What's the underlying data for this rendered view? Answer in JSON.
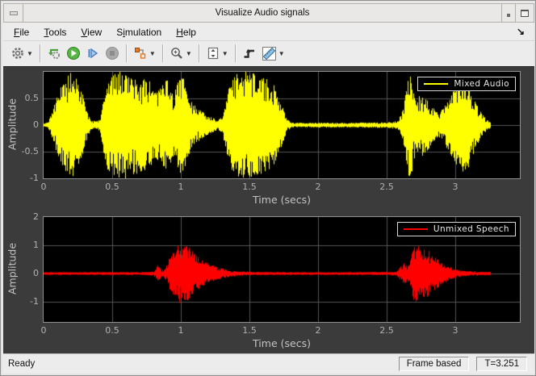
{
  "window": {
    "title": "Visualize Audio signals"
  },
  "menu": {
    "items": [
      {
        "pre": "",
        "key": "F",
        "post": "ile"
      },
      {
        "pre": "",
        "key": "T",
        "post": "ools"
      },
      {
        "pre": "",
        "key": "V",
        "post": "iew"
      },
      {
        "pre": "S",
        "key": "i",
        "post": "mulation"
      },
      {
        "pre": "",
        "key": "H",
        "post": "elp"
      }
    ],
    "dock_arrow": "↘"
  },
  "toolbar": {
    "buttons": [
      "settings-gear-dropdown",
      "step-back",
      "run-play",
      "step-forward",
      "stop",
      "signal-selector-dropdown",
      "zoom-dropdown",
      "fit-to-view-dropdown",
      "trigger",
      "measurements-ruler-dropdown"
    ]
  },
  "status": {
    "left": "Ready",
    "frame_mode": "Frame based",
    "sim_time": "T=3.251"
  },
  "colors": {
    "scope_bg": "#3b3b3b",
    "plot_bg": "#000000",
    "grid": "#565656",
    "tick_text": "#b2b2b2",
    "label_text": "#c4c4c4",
    "mixed_audio": "#ffff00",
    "unmixed_speech": "#ff0000",
    "chrome_bg": "#ececec",
    "legend_border": "#d6d6d6",
    "legend_text": "#e8e8e8"
  },
  "chart_data": [
    {
      "type": "line",
      "name": "mixed-audio-waveform",
      "legend": "Mixed Audio",
      "color": "#ffff00",
      "xlabel": "Time (secs)",
      "ylabel": "Amplitude",
      "xlim": [
        0,
        3.47
      ],
      "ylim": [
        -1,
        1
      ],
      "xticks": [
        0,
        0.5,
        1,
        1.5,
        2,
        2.5,
        3
      ],
      "xtick_labels": [
        "0",
        "0.5",
        "1",
        "1.5",
        "2",
        "2.5",
        "3"
      ],
      "yticks": [
        0.5,
        0,
        -0.5,
        -1
      ],
      "ytick_labels": [
        "0.5",
        "0",
        "-0.5",
        "-1"
      ],
      "grid": true,
      "legend_position": "top-right",
      "signal_end_time": 3.251,
      "envelope_note": "approx peak-amplitude envelope of dense audio waveform, pairs of [time_sec, amplitude]",
      "envelope": [
        [
          0.0,
          0.03
        ],
        [
          0.03,
          0.05
        ],
        [
          0.06,
          0.25
        ],
        [
          0.09,
          0.5
        ],
        [
          0.13,
          0.75
        ],
        [
          0.17,
          0.95
        ],
        [
          0.21,
          1.0
        ],
        [
          0.24,
          0.85
        ],
        [
          0.28,
          0.6
        ],
        [
          0.31,
          0.3
        ],
        [
          0.34,
          0.1
        ],
        [
          0.38,
          0.07
        ],
        [
          0.41,
          0.12
        ],
        [
          0.44,
          0.6
        ],
        [
          0.47,
          0.9
        ],
        [
          0.52,
          1.0
        ],
        [
          0.58,
          0.97
        ],
        [
          0.65,
          0.92
        ],
        [
          0.72,
          0.88
        ],
        [
          0.78,
          0.8
        ],
        [
          0.82,
          0.65
        ],
        [
          0.86,
          0.75
        ],
        [
          0.9,
          0.85
        ],
        [
          0.94,
          0.65
        ],
        [
          0.98,
          0.85
        ],
        [
          1.02,
          0.9
        ],
        [
          1.05,
          0.6
        ],
        [
          1.08,
          0.4
        ],
        [
          1.12,
          0.3
        ],
        [
          1.17,
          0.22
        ],
        [
          1.22,
          0.15
        ],
        [
          1.26,
          0.1
        ],
        [
          1.3,
          0.15
        ],
        [
          1.33,
          0.5
        ],
        [
          1.36,
          0.8
        ],
        [
          1.4,
          1.0
        ],
        [
          1.48,
          1.0
        ],
        [
          1.55,
          0.95
        ],
        [
          1.62,
          0.9
        ],
        [
          1.67,
          0.8
        ],
        [
          1.71,
          0.6
        ],
        [
          1.74,
          0.35
        ],
        [
          1.77,
          0.12
        ],
        [
          1.8,
          0.05
        ],
        [
          1.9,
          0.04
        ],
        [
          2.05,
          0.05
        ],
        [
          2.2,
          0.04
        ],
        [
          2.35,
          0.05
        ],
        [
          2.5,
          0.05
        ],
        [
          2.58,
          0.08
        ],
        [
          2.62,
          0.3
        ],
        [
          2.65,
          1.0
        ],
        [
          2.68,
          0.9
        ],
        [
          2.71,
          0.5
        ],
        [
          2.75,
          0.6
        ],
        [
          2.79,
          0.5
        ],
        [
          2.83,
          0.35
        ],
        [
          2.87,
          0.22
        ],
        [
          2.91,
          0.3
        ],
        [
          2.95,
          0.5
        ],
        [
          3.0,
          0.75
        ],
        [
          3.05,
          0.88
        ],
        [
          3.09,
          0.8
        ],
        [
          3.13,
          0.55
        ],
        [
          3.17,
          0.3
        ],
        [
          3.21,
          0.15
        ],
        [
          3.25,
          0.07
        ]
      ]
    },
    {
      "type": "line",
      "name": "unmixed-speech-waveform",
      "legend": "Unmixed Speech",
      "color": "#ff0000",
      "xlabel": "Time (secs)",
      "ylabel": "Amplitude",
      "xlim": [
        0,
        3.47
      ],
      "ylim": [
        -1.71,
        2
      ],
      "xticks": [
        0,
        0.5,
        1,
        1.5,
        2,
        2.5,
        3
      ],
      "xtick_labels": [
        "0",
        "0.5",
        "1",
        "1.5",
        "2",
        "2.5",
        "3"
      ],
      "yticks": [
        2,
        1,
        0,
        -1
      ],
      "ytick_labels": [
        "2",
        "1",
        "0",
        "-1"
      ],
      "grid": true,
      "legend_position": "top-right",
      "signal_end_time": 3.251,
      "envelope_note": "approx peak-amplitude envelope, pairs of [time_sec, amplitude]",
      "envelope": [
        [
          0.0,
          0.05
        ],
        [
          0.4,
          0.05
        ],
        [
          0.7,
          0.05
        ],
        [
          0.8,
          0.07
        ],
        [
          0.83,
          0.3
        ],
        [
          0.86,
          0.1
        ],
        [
          0.89,
          0.25
        ],
        [
          0.92,
          0.6
        ],
        [
          0.96,
          0.9
        ],
        [
          1.0,
          1.05
        ],
        [
          1.04,
          1.0
        ],
        [
          1.08,
          0.8
        ],
        [
          1.12,
          0.6
        ],
        [
          1.16,
          0.45
        ],
        [
          1.2,
          0.35
        ],
        [
          1.25,
          0.25
        ],
        [
          1.3,
          0.18
        ],
        [
          1.35,
          0.12
        ],
        [
          1.4,
          0.09
        ],
        [
          1.5,
          0.06
        ],
        [
          1.7,
          0.05
        ],
        [
          2.0,
          0.05
        ],
        [
          2.3,
          0.05
        ],
        [
          2.5,
          0.06
        ],
        [
          2.57,
          0.08
        ],
        [
          2.6,
          0.25
        ],
        [
          2.63,
          0.4
        ],
        [
          2.66,
          0.28
        ],
        [
          2.69,
          0.9
        ],
        [
          2.72,
          1.1
        ],
        [
          2.75,
          0.75
        ],
        [
          2.78,
          0.95
        ],
        [
          2.82,
          0.7
        ],
        [
          2.86,
          0.55
        ],
        [
          2.9,
          0.4
        ],
        [
          2.94,
          0.28
        ],
        [
          2.98,
          0.18
        ],
        [
          3.03,
          0.12
        ],
        [
          3.08,
          0.09
        ],
        [
          3.15,
          0.07
        ],
        [
          3.25,
          0.06
        ]
      ]
    }
  ]
}
